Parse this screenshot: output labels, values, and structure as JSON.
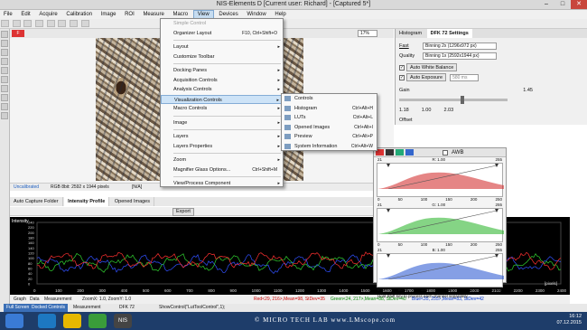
{
  "window": {
    "title": "NIS-Elements D [Current user: Richard] - [Captured 5*]",
    "controls": [
      "–",
      "□",
      "✕"
    ]
  },
  "menubar": [
    "File",
    "Edit",
    "Acquire",
    "Calibration",
    "Image",
    "ROI",
    "Measure",
    "Macro",
    "View",
    "Devices",
    "Window",
    "Help"
  ],
  "view_menu": {
    "items": [
      {
        "label": "Simple Control",
        "shortcut": "",
        "disabled": true,
        "submenu": false
      },
      {
        "label": "Organizer Layout",
        "shortcut": "F10, Ctrl+Shift+O",
        "disabled": false,
        "submenu": false
      },
      {
        "sep": true
      },
      {
        "label": "Layout",
        "shortcut": "",
        "disabled": false,
        "submenu": true
      },
      {
        "label": "Customize Toolbar",
        "shortcut": "",
        "disabled": false,
        "submenu": false
      },
      {
        "sep": true
      },
      {
        "label": "Docking Panes",
        "shortcut": "",
        "disabled": false,
        "submenu": true
      },
      {
        "label": "Acquisition Controls",
        "shortcut": "",
        "disabled": false,
        "submenu": true
      },
      {
        "label": "Analysis Controls",
        "shortcut": "",
        "disabled": false,
        "submenu": true
      },
      {
        "label": "Visualization Controls",
        "shortcut": "",
        "disabled": false,
        "submenu": true,
        "highlight": true
      },
      {
        "label": "Macro Controls",
        "shortcut": "",
        "disabled": false,
        "submenu": true
      },
      {
        "sep": true
      },
      {
        "label": "Image",
        "shortcut": "",
        "disabled": false,
        "submenu": true
      },
      {
        "sep": true
      },
      {
        "label": "Layers",
        "shortcut": "",
        "disabled": false,
        "submenu": true
      },
      {
        "label": "Layers Properties",
        "shortcut": "",
        "disabled": false,
        "submenu": true
      },
      {
        "sep": true
      },
      {
        "label": "Zoom",
        "shortcut": "",
        "disabled": false,
        "submenu": true
      },
      {
        "label": "Magnifier Glass Options...",
        "shortcut": "Ctrl+Shift+M",
        "disabled": false,
        "submenu": false
      },
      {
        "sep": true
      },
      {
        "label": "View/Process Component",
        "shortcut": "",
        "disabled": false,
        "submenu": true
      }
    ]
  },
  "visualization_submenu": [
    {
      "label": "Controls",
      "shortcut": ""
    },
    {
      "label": "Histogram",
      "shortcut": "Ctrl+Alt+H"
    },
    {
      "label": "LUTs",
      "shortcut": "Ctrl+Alt+L"
    },
    {
      "label": "Opened Images",
      "shortcut": "Ctrl+Alt+I"
    },
    {
      "label": "Preview",
      "shortcut": "Ctrl+Alt+P"
    },
    {
      "label": "System Information",
      "shortcut": "Ctrl+Alt+W"
    }
  ],
  "image_area": {
    "doc_tab_label": "F",
    "zoom": "17%",
    "status_uncalibrated": "Uncalibrated",
    "status_info": "RGB 8bit: 2592 x 1944 pixels",
    "status_na": "[N/A]"
  },
  "right_panel": {
    "tabs": [
      "Histogram",
      "DFK 72 Settings"
    ],
    "fast_label": "Fast",
    "fast_value": "Binning 2x (1296x972 px)",
    "quality_label": "Quality",
    "quality_value": "Binning 1x (2592x1944 px)",
    "awb_label": "Auto White Balance",
    "auto_exposure_label": "Auto Exposure",
    "exposure_value": "580 ms",
    "gain_label": "Gain",
    "gain_value": "1.45",
    "gain_ticks": [
      "1.18",
      "1.00",
      "2.03"
    ],
    "offset_label": "Offset"
  },
  "lut_panel": {
    "awb_label": "AWB",
    "channels": [
      {
        "name": "R",
        "gamma": "R: 1.00",
        "color": "#d02020",
        "min": "21",
        "max": "255"
      },
      {
        "name": "G",
        "gamma": "G: 1.00",
        "color": "#20b020",
        "min": "21",
        "max": "255"
      },
      {
        "name": "B",
        "gamma": "B: 1.00",
        "color": "#2050d0",
        "min": "21",
        "max": "255"
      }
    ],
    "axis_ticks": [
      "0",
      "50",
      "100",
      "150",
      "200",
      "250"
    ],
    "hint": "Hold Shift key to process each channel separately"
  },
  "lower_tabs": [
    "Auto Capture Folder",
    "Intensity Profile",
    "Opened Images"
  ],
  "profile_toolbar": {
    "export_label": "Export"
  },
  "plot": {
    "ylabel": "Intensity",
    "x_ticks": [
      "0",
      "100",
      "200",
      "300",
      "400",
      "500",
      "600",
      "700",
      "800",
      "900",
      "1000",
      "1100",
      "1200",
      "1300",
      "1400",
      "1500",
      "1600",
      "1700",
      "1800",
      "1900",
      "2000",
      "2100",
      "2200",
      "2300",
      "2400"
    ],
    "y_ticks": [
      "0",
      "20",
      "40",
      "60",
      "80",
      "100",
      "120",
      "140",
      "160",
      "180",
      "200",
      "220",
      "240"
    ],
    "unit": "[pixels]",
    "series_colors": {
      "red": "#ff3030",
      "green": "#30d030",
      "blue": "#3050ff"
    }
  },
  "plot_footer": {
    "zoom_text": "ZoomX: 1.0, ZoomY: 1.0",
    "red_stats": "Red<29, 216>,Mean=98, StDev=35",
    "green_stats": "Green<24, 217>,Mean=88, StDev=40",
    "blue_stats": "Blue<35, 255>,Mean=83, StDev=42"
  },
  "graph_tabs": [
    "Graph",
    "Data",
    "Measurement"
  ],
  "bottom_bar": {
    "tabs": [
      "Full Screen",
      "Docked Controls",
      "Measurement"
    ],
    "device": "DFK 72",
    "command": "ShowControl(\"LutToolControl\",1);"
  },
  "taskbar": {
    "watermark": "© MICRO TECH LAB  www.LMscope.com",
    "time": "16:12",
    "date": "07.12.2015"
  }
}
